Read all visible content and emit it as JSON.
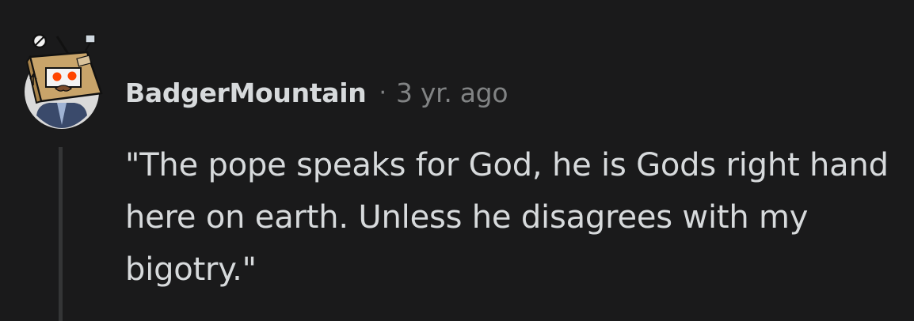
{
  "comment": {
    "author": "BadgerMountain",
    "separator": "·",
    "timestamp": "3 yr. ago",
    "body": "\"The pope speaks for God, he is Gods right hand here on earth. Unless he disagrees with my bigotry.\""
  },
  "avatar": {
    "icon": "snoo-avatar-cardboard-box-icon",
    "colors": {
      "circle": "#dadada",
      "box": "#c8a46a",
      "eye": "#ff4500",
      "shirt": "#3a4a6b"
    }
  },
  "theme": {
    "background": "#1a1a1b",
    "text": "#d7dadc",
    "meta": "#818384",
    "thread_line": "#343536"
  }
}
